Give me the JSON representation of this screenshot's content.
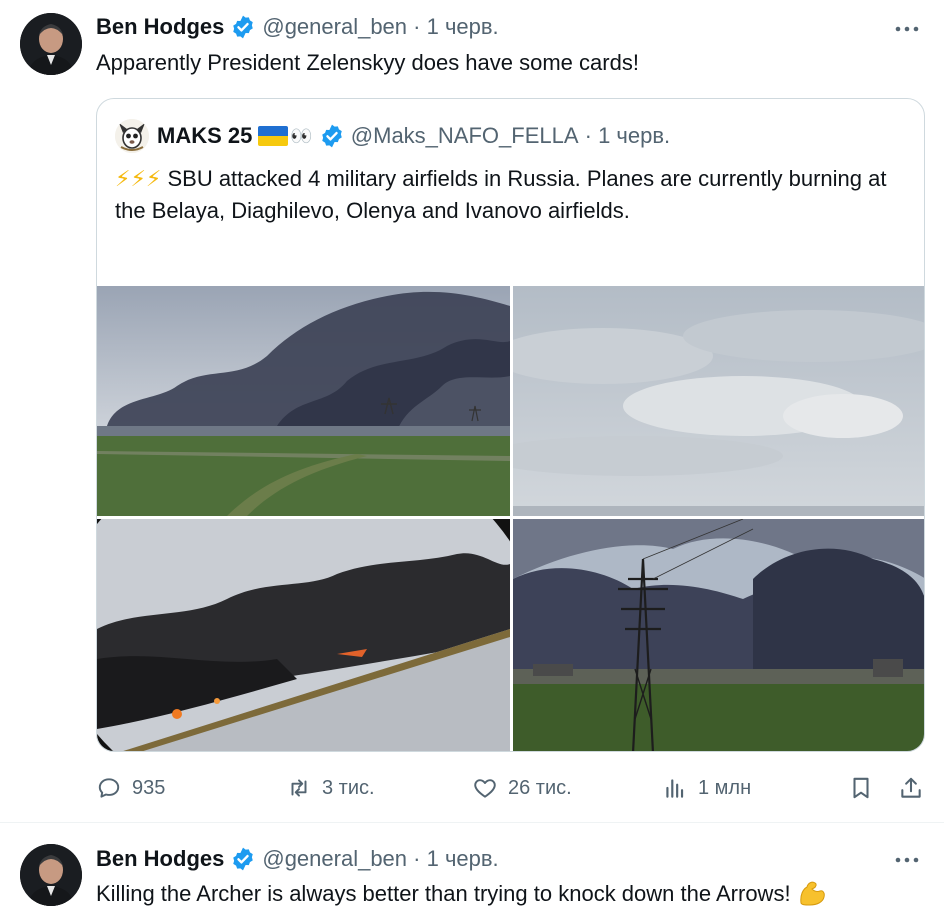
{
  "tweets": [
    {
      "author": {
        "name": "Ben Hodges",
        "handle": "@general_ben",
        "date": "1 черв."
      },
      "text": "Apparently President Zelenskyy does have some cards!",
      "quote": {
        "author": {
          "name": "MAKS 25",
          "eyes": "👀",
          "handle": "@Maks_NAFO_FELLA",
          "date": "1 черв."
        },
        "bolts": "⚡⚡⚡",
        "text": "SBU attacked 4 military airfields in Russia. Planes are currently burning at the Belaya, Diaghilevo, Olenya and Ivanovo airfields.",
        "photos": [
          {
            "icon": "photo-smoke-plumes-over-airfield"
          },
          {
            "icon": "photo-cloudy-sky"
          },
          {
            "icon": "photo-burning-aircraft-close-up"
          },
          {
            "icon": "photo-power-pylon-and-smoke"
          }
        ]
      },
      "stats": {
        "replies": "935",
        "reposts": "3 тис.",
        "likes": "26 тис.",
        "views": "1 млн"
      }
    },
    {
      "author": {
        "name": "Ben Hodges",
        "handle": "@general_ben",
        "date": "1 черв."
      },
      "text": "Killing the Archer is always better than trying to knock down the Arrows!",
      "emoji": "flexed-biceps-icon"
    }
  ],
  "colors": {
    "verified": "#1d9bf0",
    "muted": "#536471",
    "text": "#0f1419",
    "border": "#cfd9de"
  },
  "icons": [
    "more-icon",
    "verified-badge-icon",
    "reply-icon",
    "repost-icon",
    "like-icon",
    "views-icon",
    "bookmark-icon",
    "share-icon"
  ]
}
